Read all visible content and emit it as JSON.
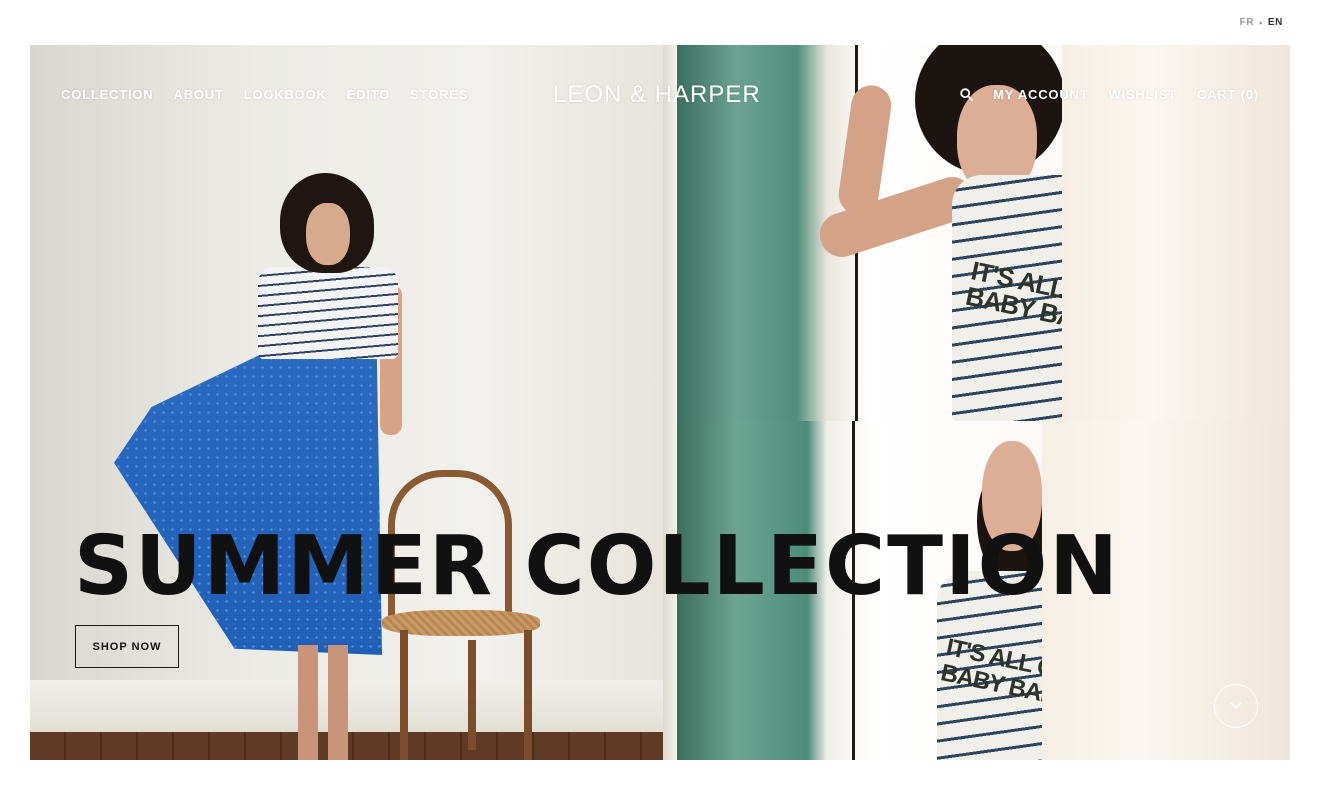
{
  "language_switcher": {
    "options": [
      "FR",
      "EN"
    ],
    "active": "EN",
    "separator": "•"
  },
  "header": {
    "brand": "LEON & HARPER",
    "nav_left": [
      {
        "label": "COLLECTION"
      },
      {
        "label": "ABOUT"
      },
      {
        "label": "LOOKBOOK"
      },
      {
        "label": "EDITO"
      },
      {
        "label": "STORES"
      }
    ],
    "nav_right": {
      "search_icon": "search-icon",
      "account": "MY ACCOUNT",
      "wishlist": "WISHLIST",
      "cart": "CART (0)"
    }
  },
  "hero": {
    "headline": "SUMMER COLLECTION",
    "cta": "SHOP NOW",
    "scroll_icon": "chevron-down-icon",
    "photo_texts": [
      "IT'S ALL GOOD",
      "BABY BABY"
    ]
  },
  "colors": {
    "nav_text": "#ffffff",
    "headline": "#111111",
    "page_bg": "#ffffff"
  }
}
